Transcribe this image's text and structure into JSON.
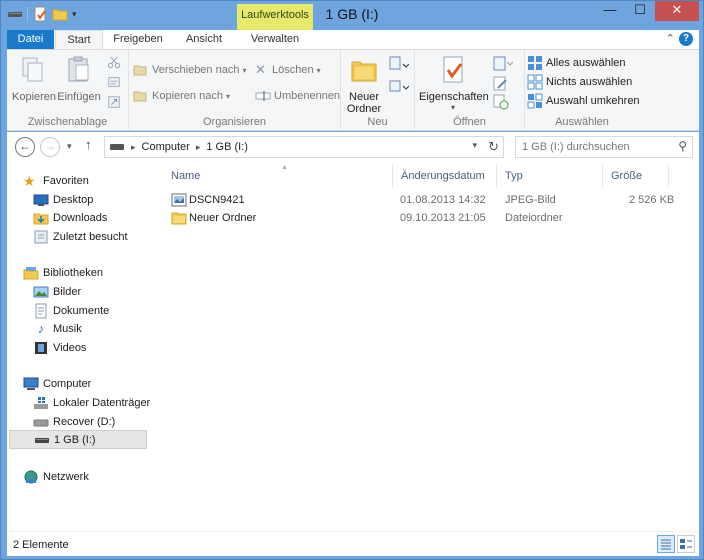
{
  "window": {
    "title": "1 GB (I:)",
    "context_tab": "Laufwerktools",
    "min": "—",
    "max": "☐",
    "close": "✕"
  },
  "tabs": [
    {
      "label": "Datei"
    },
    {
      "label": "Start"
    },
    {
      "label": "Freigeben"
    },
    {
      "label": "Ansicht"
    },
    {
      "label": "Verwalten"
    }
  ],
  "help_label": "?",
  "ribbon": {
    "clipboard": {
      "label": "Zwischenablage",
      "copy": "Kopieren",
      "paste": "Einfügen"
    },
    "organize": {
      "label": "Organisieren",
      "move_to": "Verschieben nach",
      "copy_to": "Kopieren nach",
      "delete": "Löschen",
      "rename": "Umbenennen"
    },
    "new": {
      "label": "Neu",
      "new_folder_line1": "Neuer",
      "new_folder_line2": "Ordner"
    },
    "open": {
      "label": "Öffnen",
      "properties": "Eigenschaften"
    },
    "select": {
      "label": "Auswählen",
      "select_all": "Alles auswählen",
      "select_none": "Nichts auswählen",
      "invert": "Auswahl umkehren"
    }
  },
  "address": {
    "crumbs": [
      "Computer",
      "1 GB (I:)"
    ],
    "search_placeholder": "1 GB (I:) durchsuchen"
  },
  "nav": {
    "favorites": "Favoriten",
    "fav_items": [
      "Desktop",
      "Downloads",
      "Zuletzt besucht"
    ],
    "libraries": "Bibliotheken",
    "lib_items": [
      "Bilder",
      "Dokumente",
      "Musik",
      "Videos"
    ],
    "computer": "Computer",
    "comp_items": [
      "Lokaler Datenträger",
      "Recover (D:)",
      "1 GB (I:)"
    ],
    "network": "Netzwerk"
  },
  "columns": {
    "name": "Name",
    "date": "Änderungsdatum",
    "type": "Typ",
    "size": "Größe"
  },
  "files": [
    {
      "name": "DSCN9421",
      "date": "01.08.2013 14:32",
      "type": "JPEG-Bild",
      "size": "2 526 KB"
    },
    {
      "name": "Neuer Ordner",
      "date": "09.10.2013 21:05",
      "type": "Dateiordner",
      "size": ""
    }
  ],
  "status": "2 Elemente",
  "colors": {
    "accent": "#1979ca",
    "context_tab": "#e8e86a",
    "frame": "#6fa5df"
  }
}
